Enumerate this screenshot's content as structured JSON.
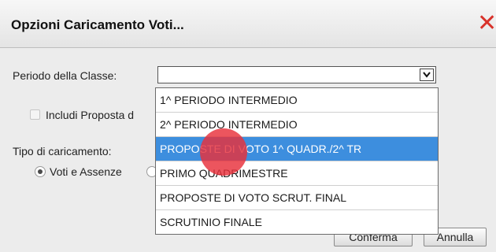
{
  "dialog": {
    "title": "Opzioni Caricamento Voti...",
    "close_icon": "close-icon",
    "accent_close": "#d8322a"
  },
  "form": {
    "periodo_label": "Periodo della Classe:",
    "periodo_value": "",
    "includi_label": "Includi Proposta d",
    "includi_checked": false,
    "tipo_label": "Tipo di caricamento:",
    "radio_voti_label": "Voti e Assenze",
    "radio_voti_selected": true
  },
  "dropdown": {
    "options": [
      "1^ PERIODO INTERMEDIO",
      "2^ PERIODO INTERMEDIO",
      "PROPOSTE DI VOTO 1^ QUADR./2^ TR",
      "PRIMO QUADRIMESTRE",
      "PROPOSTE DI VOTO SCRUT. FINAL",
      "SCRUTINIO FINALE"
    ],
    "highlighted_index": 2,
    "highlight_color": "#3d8ede"
  },
  "buttons": {
    "confirm_label": "Conferma",
    "cancel_label": "Annulla"
  }
}
